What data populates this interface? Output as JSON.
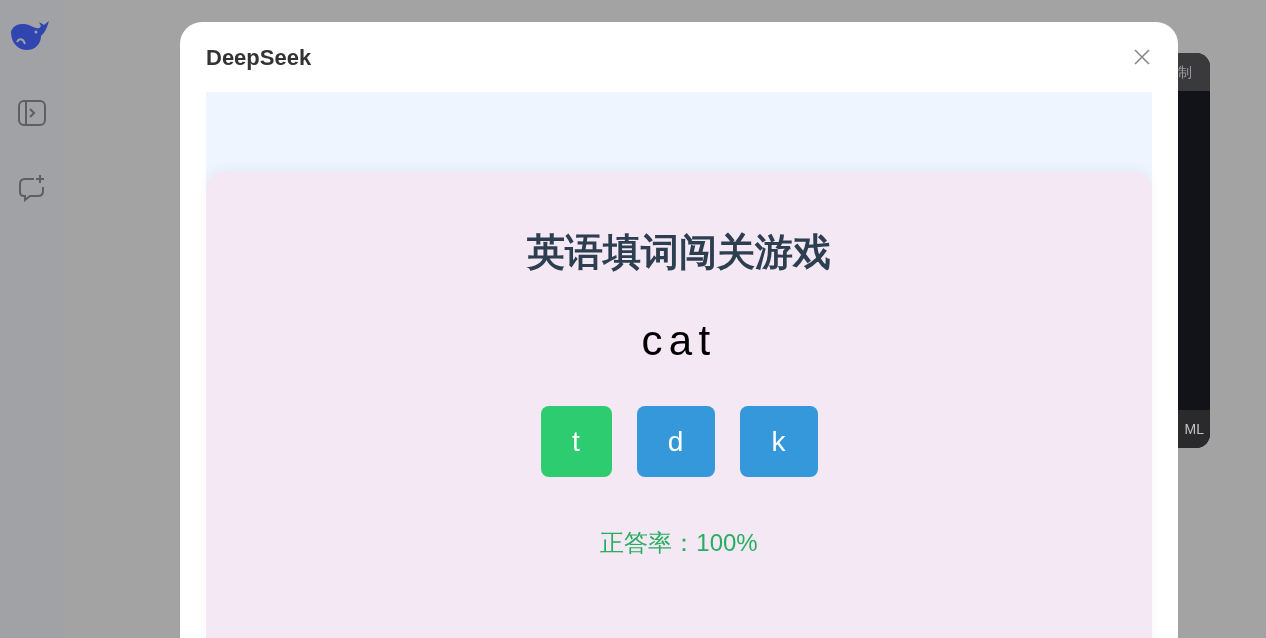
{
  "background_panel": {
    "header_text": "制",
    "footer_text": "ML"
  },
  "dialog": {
    "title": "DeepSeek",
    "game": {
      "title": "英语填词闯关游戏",
      "word": "cat",
      "options": [
        {
          "label": "t",
          "selected": true
        },
        {
          "label": "d",
          "selected": false
        },
        {
          "label": "k",
          "selected": false
        }
      ],
      "accuracy": "正答率：100%"
    }
  }
}
